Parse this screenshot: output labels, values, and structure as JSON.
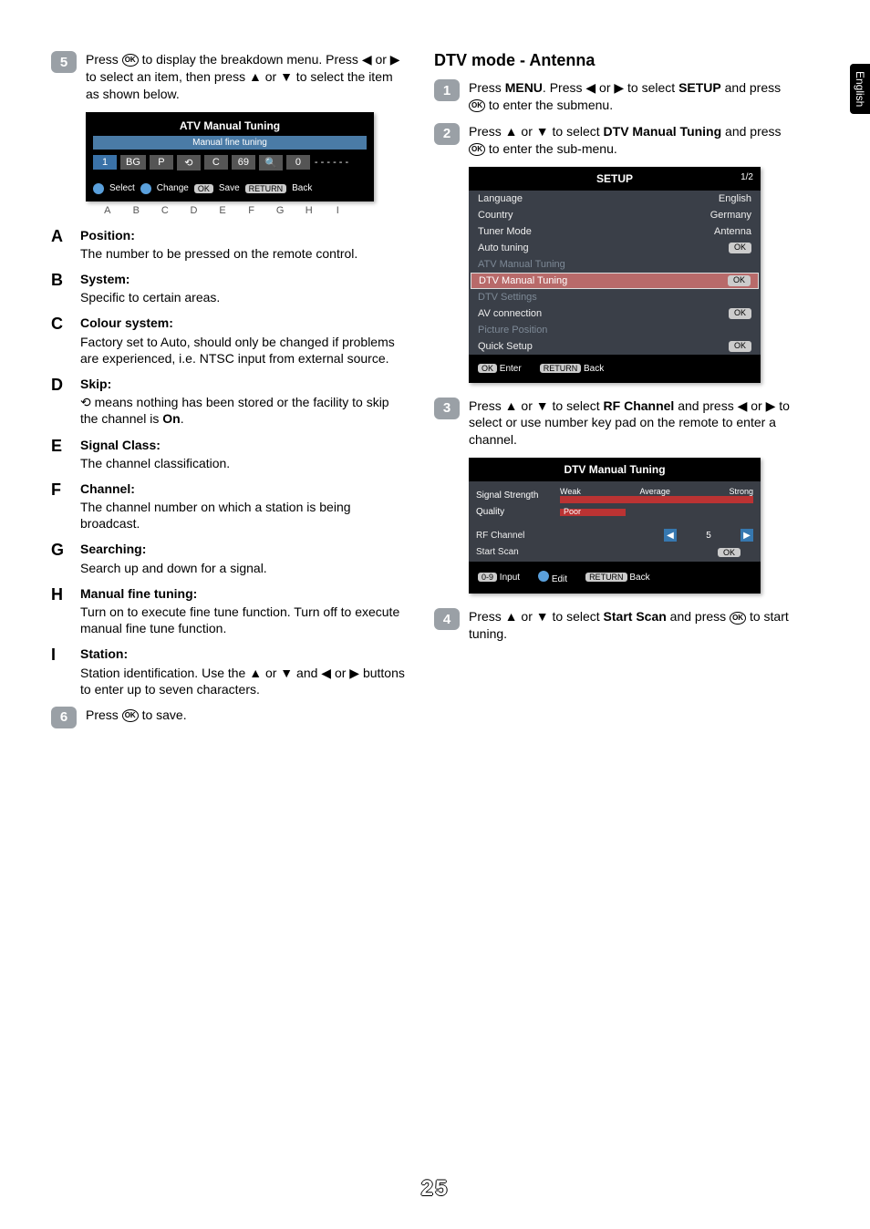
{
  "lang_tab": "English",
  "page_number": "25",
  "left": {
    "step5": {
      "num": "5",
      "text_parts": {
        "a": "Press ",
        "ok": "OK",
        "b": " to display the breakdown menu. Press ◀ or ▶ to select an item, then press ▲ or ▼ to select the item as shown below."
      }
    },
    "atv_panel": {
      "title": "ATV Manual Tuning",
      "subtitle": "Manual fine tuning",
      "cells": {
        "n1": "1",
        "bg": "BG",
        "p": "P",
        "c": "C",
        "ch": "69",
        "q": "0"
      },
      "hints": {
        "select": "Select",
        "change": "Change",
        "save": "Save",
        "back": "Back",
        "ok": "OK",
        "return": "RETURN"
      }
    },
    "col_labels": [
      "A",
      "B",
      "C",
      "D",
      "E",
      "F",
      "G",
      "H",
      "I"
    ],
    "defs": [
      {
        "letter": "A",
        "term": "Position:",
        "body": "The number to be pressed on the remote control."
      },
      {
        "letter": "B",
        "term": "System:",
        "body": "Specific to certain areas."
      },
      {
        "letter": "C",
        "term": "Colour system:",
        "body": "Factory set to Auto, should only be changed if problems are experienced, i.e. NTSC input from external source."
      },
      {
        "letter": "D",
        "term": "Skip:",
        "body": "  means nothing has been stored or the facility to skip the channel is ",
        "body_on": "On",
        "body_tail": "."
      },
      {
        "letter": "E",
        "term": "Signal Class:",
        "body": "The channel classification."
      },
      {
        "letter": "F",
        "term": "Channel:",
        "body": "The channel number on which a station is being broadcast."
      },
      {
        "letter": "G",
        "term": "Searching:",
        "body": "Search up and down for a signal."
      },
      {
        "letter": "H",
        "term": "Manual fine tuning:",
        "body": "Turn on to execute fine tune function. Turn off to execute manual fine tune function."
      },
      {
        "letter": "I",
        "term": "Station:",
        "body": "Station identification. Use the ▲ or ▼ and ◀ or ▶ buttons to enter up to seven characters."
      }
    ],
    "step6": {
      "num": "6",
      "a": "Press ",
      "ok": "OK",
      "b": " to save."
    }
  },
  "right": {
    "heading": "DTV mode - Antenna",
    "step1": {
      "num": "1",
      "a": "Press ",
      "menu": "MENU",
      "b": ". Press ◀ or ▶ to select ",
      "setup": "SETUP",
      "c": " and press ",
      "ok": "OK",
      "d": " to enter  the submenu."
    },
    "step2": {
      "num": "2",
      "a": "Press ▲ or ▼ to select ",
      "term": "DTV Manual Tuning",
      "b": " and press ",
      "ok": "OK",
      "c": " to enter the sub-menu."
    },
    "setup_panel": {
      "title": "SETUP",
      "page": "1/2",
      "rows": [
        {
          "k": "Language",
          "v": "English"
        },
        {
          "k": "Country",
          "v": "Germany"
        },
        {
          "k": "Tuner Mode",
          "v": "Antenna"
        },
        {
          "k": "Auto tuning",
          "v": "OK"
        },
        {
          "k": "ATV Manual Tuning",
          "v": "",
          "dim": true
        },
        {
          "k": "DTV Manual Tuning",
          "v": "OK",
          "hl": true
        },
        {
          "k": "DTV Settings",
          "v": "",
          "dim": true
        },
        {
          "k": "AV connection",
          "v": "OK"
        },
        {
          "k": "Picture Position",
          "v": "",
          "dim": true
        },
        {
          "k": "Quick Setup",
          "v": "OK"
        }
      ],
      "foot": {
        "ok": "OK",
        "enter": "Enter",
        "return": "RETURN",
        "back": "Back"
      }
    },
    "step3": {
      "num": "3",
      "a": "Press ▲ or ▼ to select ",
      "term": "RF Channel",
      "b": " and press ◀ or ▶  to select or use number key pad on the remote to enter a channel."
    },
    "dtv_panel": {
      "title": "DTV Manual Tuning",
      "labels": {
        "weak": "Weak",
        "avg": "Average",
        "strong": "Strong"
      },
      "rows": {
        "ss": "Signal Strength",
        "q": "Quality",
        "poor": "Poor",
        "rf": "RF Channel",
        "rf_v": "5",
        "scan": "Start Scan",
        "ok": "OK"
      },
      "foot": {
        "input": "Input",
        "edit": "Edit",
        "return": "RETURN",
        "back": "Back",
        "numpad": "0-9"
      }
    },
    "step4": {
      "num": "4",
      "a": "Press ▲ or ▼ to select ",
      "term": "Start Scan",
      "b": " and press ",
      "ok": "OK",
      "c": " to start tuning."
    }
  }
}
